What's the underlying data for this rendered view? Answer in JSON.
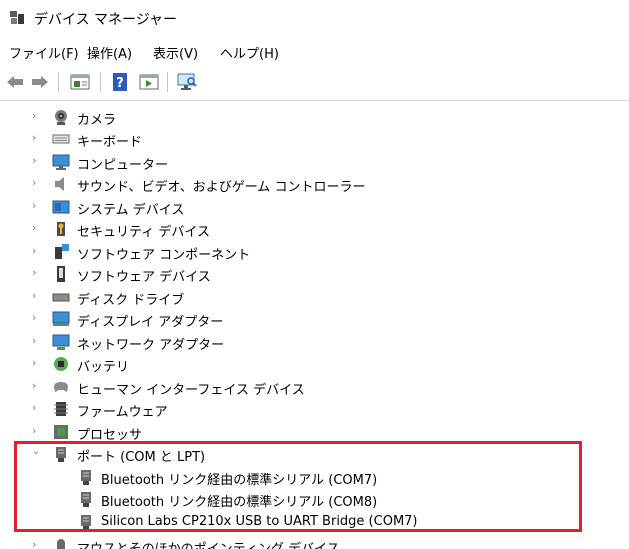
{
  "window": {
    "title": "デバイス マネージャー"
  },
  "menu": [
    "ファイル(F)",
    "操作(A)",
    "表示(V)",
    "ヘルプ(H)"
  ],
  "toolbar": {
    "buttons": [
      "back-icon",
      "forward-icon",
      "properties-icon",
      "help-icon",
      "run-icon",
      "monitor-scan-icon"
    ]
  },
  "tree": {
    "items": [
      {
        "label": "カメラ",
        "icon": "camera-icon",
        "expanded": false
      },
      {
        "label": "キーボード",
        "icon": "keyboard-icon",
        "expanded": false
      },
      {
        "label": "コンピューター",
        "icon": "computer-icon",
        "expanded": false
      },
      {
        "label": "サウンド、ビデオ、およびゲーム コントローラー",
        "icon": "speaker-icon",
        "expanded": false
      },
      {
        "label": "システム デバイス",
        "icon": "system-folder-icon",
        "expanded": false
      },
      {
        "label": "セキュリティ デバイス",
        "icon": "security-key-icon",
        "expanded": false
      },
      {
        "label": "ソフトウェア コンポーネント",
        "icon": "software-component-icon",
        "expanded": false
      },
      {
        "label": "ソフトウェア デバイス",
        "icon": "software-device-icon",
        "expanded": false
      },
      {
        "label": "ディスク ドライブ",
        "icon": "disk-drive-icon",
        "expanded": false
      },
      {
        "label": "ディスプレイ アダプター",
        "icon": "display-adapter-icon",
        "expanded": false
      },
      {
        "label": "ネットワーク アダプター",
        "icon": "network-adapter-icon",
        "expanded": false
      },
      {
        "label": "バッテリ",
        "icon": "battery-icon",
        "expanded": false
      },
      {
        "label": "ヒューマン インターフェイス デバイス",
        "icon": "hid-icon",
        "expanded": false
      },
      {
        "label": "ファームウェア",
        "icon": "firmware-icon",
        "expanded": false
      },
      {
        "label": "プロセッサ",
        "icon": "processor-icon",
        "expanded": false
      },
      {
        "label": "ポート (COM と LPT)",
        "icon": "port-icon",
        "expanded": true
      },
      {
        "label": "Bluetooth リンク経由の標準シリアル (COM7)",
        "icon": "port-icon",
        "child": true
      },
      {
        "label": "Bluetooth リンク経由の標準シリアル (COM8)",
        "icon": "port-icon",
        "child": true
      },
      {
        "label": "Silicon Labs CP210x USB to UART Bridge (COM7)",
        "icon": "port-icon",
        "child": true
      },
      {
        "label": "マウスとそのほかのポインティング デバイス",
        "icon": "mouse-icon",
        "expanded": false
      }
    ]
  },
  "colors": {
    "highlight": "#e0202a"
  }
}
